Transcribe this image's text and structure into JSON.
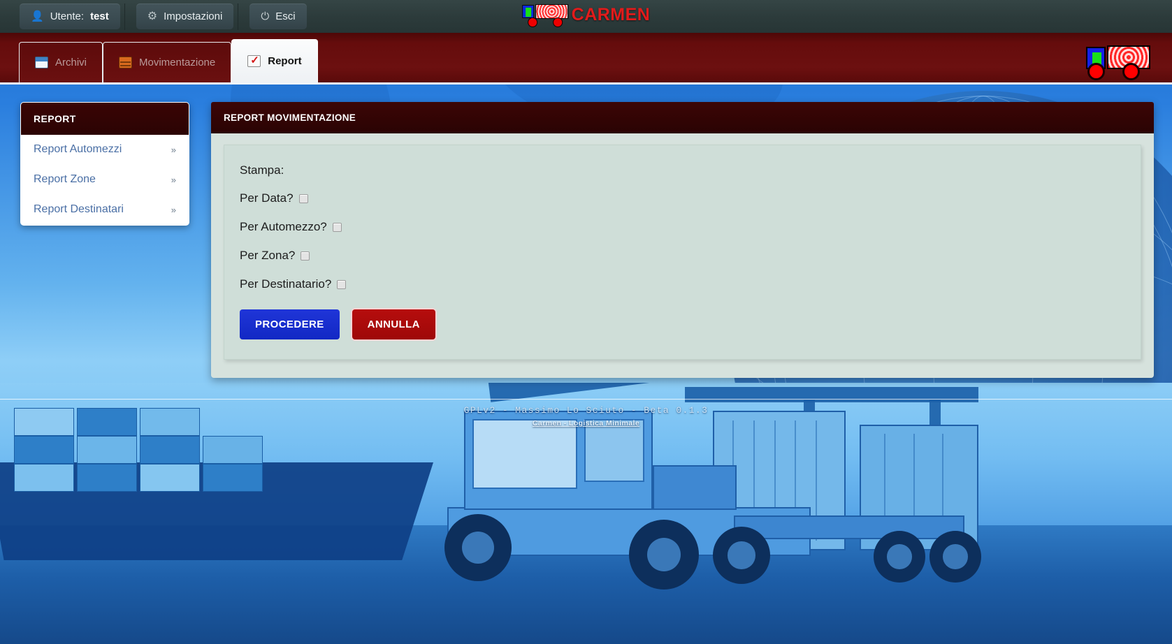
{
  "topbar": {
    "user_icon": "user-icon",
    "user_label": "Utente:",
    "user_name": "test",
    "settings_icon": "gear-icon",
    "settings_label": "Impostazioni",
    "logout_icon": "power-icon",
    "logout_label": "Esci"
  },
  "brand": {
    "name": "CARMEN",
    "logo_icon": "truck-logo-icon",
    "color": "#e21b1b"
  },
  "nav": {
    "tabs": [
      {
        "label": "Archivi",
        "icon": "archive-icon",
        "active": false
      },
      {
        "label": "Movimentazione",
        "icon": "barrel-icon",
        "active": false
      },
      {
        "label": "Report",
        "icon": "checklist-icon",
        "active": true
      }
    ],
    "right_logo_icon": "truck-logo-icon",
    "bar_color": "#650c0c"
  },
  "sidebar": {
    "title": "REPORT",
    "items": [
      {
        "label": "Report Automezzi",
        "chevron": "»"
      },
      {
        "label": "Report Zone",
        "chevron": "»"
      },
      {
        "label": "Report Destinatari",
        "chevron": "»"
      }
    ]
  },
  "panel": {
    "title": "REPORT MOVIMENTAZIONE",
    "form": {
      "heading": "Stampa:",
      "options": [
        {
          "label": "Per Data?",
          "checked": false
        },
        {
          "label": "Per Automezzo?",
          "checked": false
        },
        {
          "label": "Per Zona?",
          "checked": false
        },
        {
          "label": "Per Destinatario?",
          "checked": false
        }
      ],
      "submit_label": "PROCEDERE",
      "cancel_label": "ANNULLA",
      "submit_color": "#1228c4",
      "cancel_color": "#9e0808"
    }
  },
  "footer": {
    "line1": "GPLv2 - Massimo Lo Sciuto - Beta 0.1.3",
    "line2": "Carmen - Logistica Minimale"
  }
}
